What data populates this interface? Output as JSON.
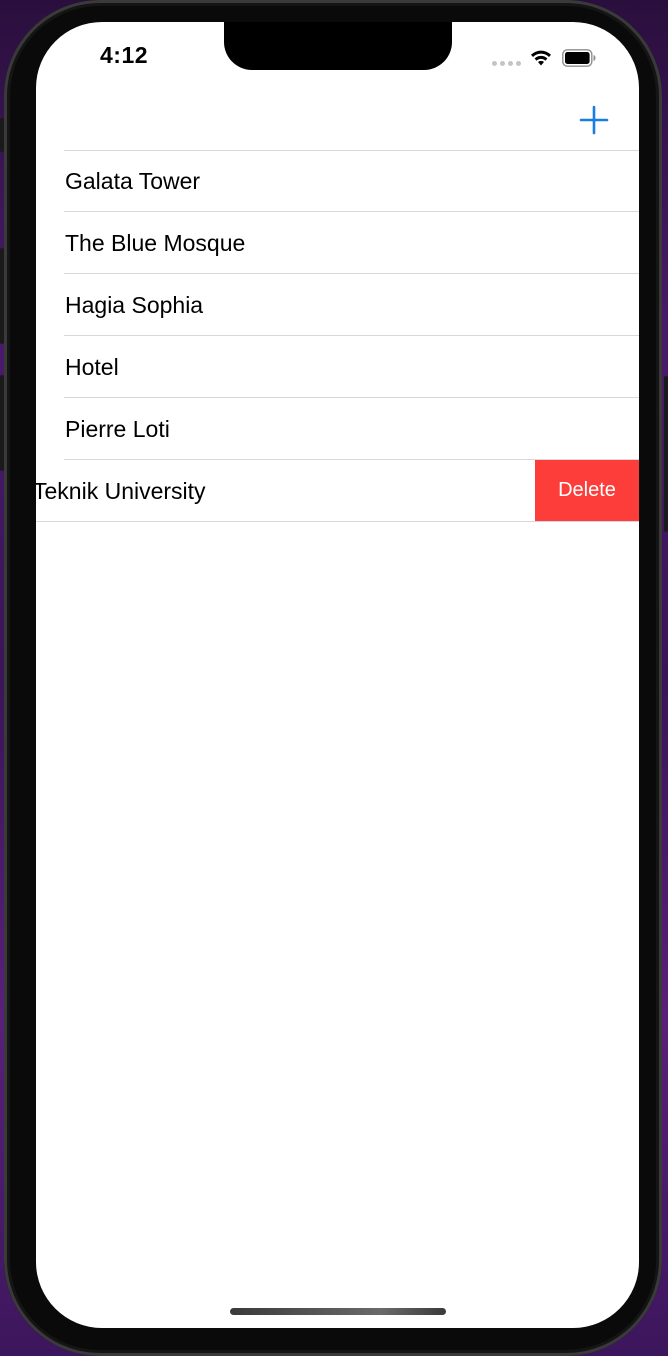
{
  "status_bar": {
    "time": "4:12"
  },
  "navbar": {
    "add_icon": "plus-icon",
    "accent_color": "#1a7ee0"
  },
  "list": {
    "items": [
      {
        "label": "Galata Tower"
      },
      {
        "label": "The Blue Mosque"
      },
      {
        "label": "Hagia Sophia"
      },
      {
        "label": "Hotel"
      },
      {
        "label": "Pierre Loti"
      },
      {
        "label": "Teknik University",
        "visible_label": "́eknik University",
        "swiped": true
      }
    ],
    "delete_label": "Delete",
    "delete_color": "#fc3d39"
  }
}
